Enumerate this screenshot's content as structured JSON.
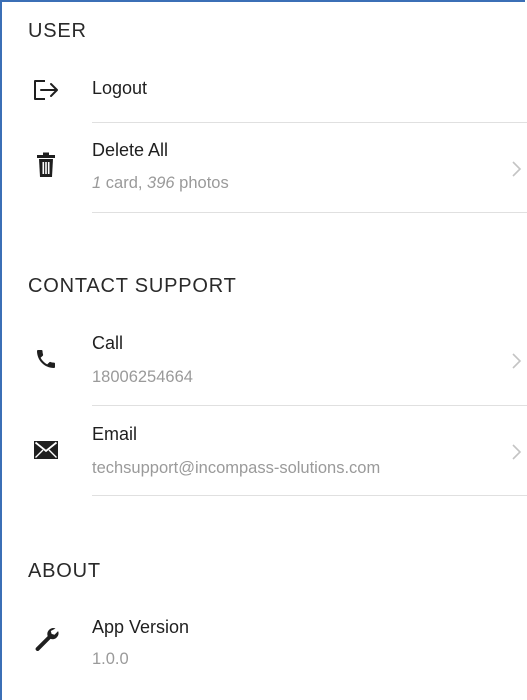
{
  "sections": {
    "user": {
      "header": "USER",
      "logout": {
        "label": "Logout",
        "icon": "logout-icon"
      },
      "delete_all": {
        "label": "Delete All",
        "icon": "trash-icon",
        "cards_count": "1",
        "cards_text": " card, ",
        "photos_count": "396",
        "photos_text": " photos"
      }
    },
    "contact_support": {
      "header": "CONTACT SUPPORT",
      "call": {
        "label": "Call",
        "value": "18006254664",
        "icon": "phone-icon"
      },
      "email": {
        "label": "Email",
        "value": "techsupport@incompass-solutions.com",
        "icon": "envelope-icon"
      }
    },
    "about": {
      "header": "ABOUT",
      "app_version": {
        "label": "App Version",
        "value": "1.0.0",
        "icon": "wrench-icon"
      }
    }
  },
  "colors": {
    "frame_border": "#3b6fb6",
    "divider": "#e0e0e0",
    "subtitle": "#9a9a9a",
    "chevron": "#c4c4c4"
  }
}
